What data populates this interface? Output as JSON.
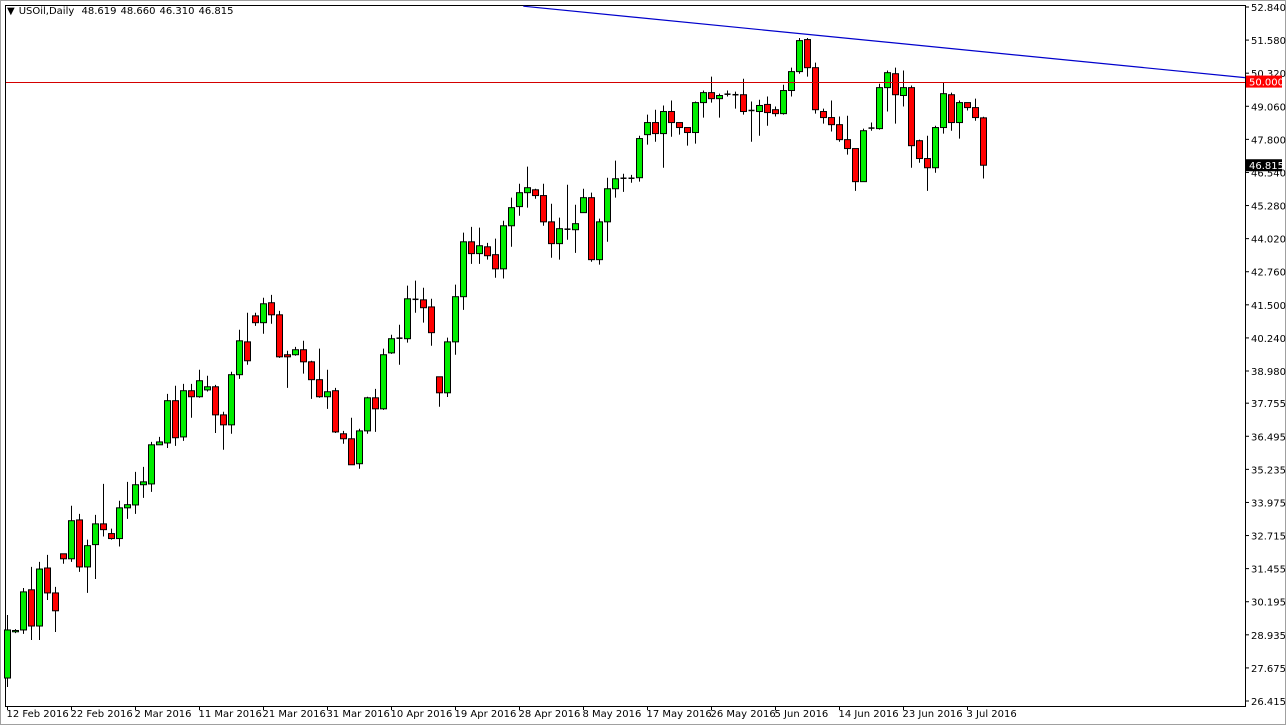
{
  "header": {
    "symbol": "USOil,Daily",
    "open": "48.619",
    "high": "48.660",
    "low": "46.310",
    "close": "46.815",
    "menu_icon": "triangle-down-icon"
  },
  "colors": {
    "bull": "#00ee00",
    "bear": "#ff0000",
    "outline": "#000000",
    "trendline": "#0000cc",
    "level_line": "#d40000",
    "level_label_bg": "#ff0000",
    "price_label_bg": "#000000"
  },
  "chart_data": {
    "type": "candlestick",
    "title": "USOil,Daily",
    "ylim": [
      26.415,
      52.84
    ],
    "grid": false,
    "yticks": [
      "52.840",
      "51.580",
      "50.320",
      "49.060",
      "47.800",
      "46.540",
      "45.280",
      "44.020",
      "42.760",
      "41.500",
      "40.240",
      "38.980",
      "37.755",
      "36.495",
      "35.235",
      "33.975",
      "32.715",
      "31.455",
      "30.195",
      "28.935",
      "27.675",
      "26.415"
    ],
    "xticks": [
      {
        "bar": 0,
        "label": "12 Feb 2016"
      },
      {
        "bar": 8,
        "label": "22 Feb 2016"
      },
      {
        "bar": 16,
        "label": "2 Mar 2016"
      },
      {
        "bar": 24,
        "label": "11 Mar 2016"
      },
      {
        "bar": 32,
        "label": "21 Mar 2016"
      },
      {
        "bar": 40,
        "label": "31 Mar 2016"
      },
      {
        "bar": 48,
        "label": "10 Apr 2016"
      },
      {
        "bar": 56,
        "label": "19 Apr 2016"
      },
      {
        "bar": 64,
        "label": "28 Apr 2016"
      },
      {
        "bar": 72,
        "label": "8 May 2016"
      },
      {
        "bar": 80,
        "label": "17 May 2016"
      },
      {
        "bar": 88,
        "label": "26 May 2016"
      },
      {
        "bar": 96,
        "label": "5 Jun 2016"
      },
      {
        "bar": 104,
        "label": "14 Jun 2016"
      },
      {
        "bar": 112,
        "label": "23 Jun 2016"
      },
      {
        "bar": 120,
        "label": "3 Jul 2016"
      }
    ],
    "horizontal_line": {
      "price": 50.0,
      "label": "50.000"
    },
    "current_price": {
      "price": 46.815,
      "label": "46.815"
    },
    "trendline": {
      "from": {
        "bar": 64.6,
        "price": 52.87
      },
      "to": {
        "bar": 154.8,
        "price": 50.15
      }
    },
    "ohlc_fields": [
      "open",
      "high",
      "low",
      "close"
    ],
    "candles": [
      [
        27.29,
        29.69,
        26.95,
        29.12
      ],
      [
        29.05,
        29.15,
        29.0,
        29.1
      ],
      [
        29.12,
        30.72,
        28.97,
        30.57
      ],
      [
        30.65,
        31.52,
        28.74,
        29.27
      ],
      [
        29.27,
        31.71,
        28.74,
        31.44
      ],
      [
        31.48,
        31.98,
        30.26,
        30.53
      ],
      [
        30.53,
        30.76,
        29.04,
        29.85
      ],
      [
        32.02,
        32.02,
        31.64,
        31.83
      ],
      [
        31.83,
        33.85,
        31.71,
        33.28
      ],
      [
        33.31,
        33.54,
        31.33,
        31.52
      ],
      [
        31.52,
        32.56,
        30.53,
        32.33
      ],
      [
        32.37,
        33.5,
        31.06,
        33.16
      ],
      [
        33.16,
        34.68,
        32.68,
        32.94
      ],
      [
        32.79,
        32.98,
        32.56,
        32.6
      ],
      [
        32.6,
        34.04,
        32.3,
        33.77
      ],
      [
        33.77,
        34.76,
        33.35,
        33.89
      ],
      [
        33.88,
        35.14,
        33.54,
        34.65
      ],
      [
        34.65,
        35.33,
        34.15,
        34.76
      ],
      [
        34.68,
        36.28,
        34.38,
        36.17
      ],
      [
        36.17,
        36.47,
        36.17,
        36.28
      ],
      [
        36.24,
        38.11,
        36.05,
        37.85
      ],
      [
        37.85,
        38.42,
        36.13,
        36.44
      ],
      [
        36.47,
        38.49,
        36.32,
        38.23
      ],
      [
        38.23,
        38.49,
        37.2,
        38.0
      ],
      [
        38.0,
        39.03,
        37.96,
        38.61
      ],
      [
        38.26,
        38.8,
        38.2,
        38.38
      ],
      [
        38.38,
        38.45,
        36.62,
        37.31
      ],
      [
        37.31,
        37.43,
        35.98,
        36.93
      ],
      [
        36.93,
        38.95,
        36.59,
        38.84
      ],
      [
        38.84,
        40.55,
        38.68,
        40.13
      ],
      [
        40.09,
        41.2,
        39.22,
        39.37
      ],
      [
        41.08,
        41.2,
        40.7,
        40.82
      ],
      [
        40.82,
        41.77,
        40.4,
        41.54
      ],
      [
        41.58,
        41.88,
        40.78,
        41.12
      ],
      [
        41.12,
        41.27,
        39.48,
        39.52
      ],
      [
        39.6,
        39.75,
        38.34,
        39.52
      ],
      [
        39.6,
        39.9,
        39.56,
        39.79
      ],
      [
        39.79,
        40.13,
        38.88,
        39.33
      ],
      [
        39.33,
        39.37,
        37.92,
        38.65
      ],
      [
        38.65,
        39.83,
        37.96,
        38.0
      ],
      [
        38.0,
        39.03,
        37.54,
        38.19
      ],
      [
        38.23,
        38.34,
        36.62,
        36.66
      ],
      [
        36.59,
        36.7,
        36.21,
        36.4
      ],
      [
        36.4,
        37.2,
        35.41,
        35.41
      ],
      [
        35.45,
        36.78,
        35.26,
        36.7
      ],
      [
        36.7,
        38.0,
        36.59,
        37.96
      ],
      [
        37.96,
        38.3,
        36.66,
        37.54
      ],
      [
        37.54,
        39.83,
        37.5,
        39.6
      ],
      [
        39.67,
        40.36,
        39.63,
        40.21
      ],
      [
        40.21,
        40.74,
        39.22,
        40.25
      ],
      [
        40.21,
        42.23,
        40.06,
        41.73
      ],
      [
        41.69,
        42.42,
        41.2,
        41.73
      ],
      [
        41.69,
        42.15,
        40.82,
        41.39
      ],
      [
        41.42,
        41.73,
        39.94,
        40.44
      ],
      [
        38.76,
        38.76,
        37.62,
        38.15
      ],
      [
        38.15,
        40.25,
        37.99,
        40.09
      ],
      [
        40.09,
        42.27,
        39.6,
        41.81
      ],
      [
        41.81,
        44.25,
        41.31,
        43.9
      ],
      [
        43.9,
        44.47,
        43.06,
        43.45
      ],
      [
        43.45,
        44.44,
        43.06,
        43.75
      ],
      [
        43.71,
        43.86,
        43.22,
        43.37
      ],
      [
        43.41,
        44.02,
        42.53,
        42.87
      ],
      [
        42.87,
        44.7,
        42.5,
        44.51
      ],
      [
        44.51,
        45.58,
        43.71,
        45.2
      ],
      [
        45.24,
        46.11,
        44.89,
        45.77
      ],
      [
        45.77,
        46.76,
        45.2,
        45.96
      ],
      [
        45.88,
        45.92,
        45.54,
        45.66
      ],
      [
        45.66,
        46.11,
        44.51,
        44.66
      ],
      [
        44.66,
        45.35,
        43.29,
        43.83
      ],
      [
        43.83,
        44.82,
        43.22,
        44.4
      ],
      [
        44.36,
        46.07,
        43.98,
        44.4
      ],
      [
        44.36,
        45.31,
        43.48,
        44.59
      ],
      [
        45.01,
        45.92,
        45.01,
        45.58
      ],
      [
        45.58,
        45.77,
        43.14,
        43.22
      ],
      [
        43.22,
        44.78,
        43.03,
        44.66
      ],
      [
        44.66,
        46.34,
        43.9,
        45.92
      ],
      [
        45.92,
        46.99,
        45.58,
        46.3
      ],
      [
        46.3,
        46.49,
        45.8,
        46.34
      ],
      [
        46.3,
        46.45,
        46.15,
        46.34
      ],
      [
        46.34,
        47.94,
        46.19,
        47.83
      ],
      [
        47.98,
        48.74,
        47.6,
        48.44
      ],
      [
        48.44,
        48.93,
        47.71,
        48.02
      ],
      [
        48.02,
        49.09,
        46.72,
        48.86
      ],
      [
        48.86,
        49.28,
        47.9,
        48.44
      ],
      [
        48.44,
        48.44,
        47.98,
        48.25
      ],
      [
        48.25,
        48.25,
        47.56,
        48.06
      ],
      [
        48.06,
        49.24,
        47.64,
        49.2
      ],
      [
        49.2,
        49.66,
        48.63,
        49.58
      ],
      [
        49.58,
        50.19,
        49.2,
        49.35
      ],
      [
        49.35,
        49.54,
        48.63,
        49.47
      ],
      [
        49.5,
        49.66,
        49.43,
        49.54
      ],
      [
        49.5,
        49.62,
        48.97,
        49.5
      ],
      [
        49.5,
        50.11,
        48.74,
        48.86
      ],
      [
        48.9,
        49.24,
        47.71,
        48.9
      ],
      [
        48.86,
        49.31,
        47.94,
        49.09
      ],
      [
        49.13,
        49.43,
        48.32,
        48.82
      ],
      [
        48.93,
        49.05,
        48.67,
        48.78
      ],
      [
        48.78,
        49.88,
        48.74,
        49.66
      ],
      [
        49.66,
        50.53,
        49.43,
        50.38
      ],
      [
        50.38,
        51.66,
        50.3,
        51.56
      ],
      [
        51.6,
        51.66,
        50.19,
        50.53
      ],
      [
        50.53,
        50.72,
        48.78,
        48.93
      ],
      [
        48.86,
        48.97,
        48.4,
        48.63
      ],
      [
        48.63,
        49.28,
        48.1,
        48.36
      ],
      [
        48.36,
        48.67,
        47.71,
        47.79
      ],
      [
        47.79,
        48.7,
        47.22,
        47.45
      ],
      [
        47.45,
        47.45,
        45.84,
        46.19
      ],
      [
        46.19,
        48.21,
        46.19,
        48.13
      ],
      [
        48.21,
        48.44,
        48.13,
        48.25
      ],
      [
        48.21,
        49.92,
        48.17,
        49.77
      ],
      [
        49.77,
        50.42,
        48.86,
        50.34
      ],
      [
        50.3,
        50.53,
        48.4,
        49.5
      ],
      [
        49.47,
        50.42,
        49.05,
        49.77
      ],
      [
        49.77,
        49.85,
        46.72,
        47.56
      ],
      [
        47.75,
        47.79,
        46.91,
        47.07
      ],
      [
        47.07,
        47.94,
        45.84,
        46.72
      ],
      [
        46.72,
        48.32,
        46.53,
        48.25
      ],
      [
        48.25,
        49.96,
        48.02,
        49.54
      ],
      [
        49.5,
        49.58,
        48.13,
        48.44
      ],
      [
        48.44,
        49.28,
        47.83,
        49.2
      ],
      [
        49.2,
        49.2,
        48.9,
        49.01
      ],
      [
        49.01,
        49.35,
        48.51,
        48.63
      ],
      [
        48.619,
        48.66,
        46.31,
        46.815
      ]
    ]
  }
}
